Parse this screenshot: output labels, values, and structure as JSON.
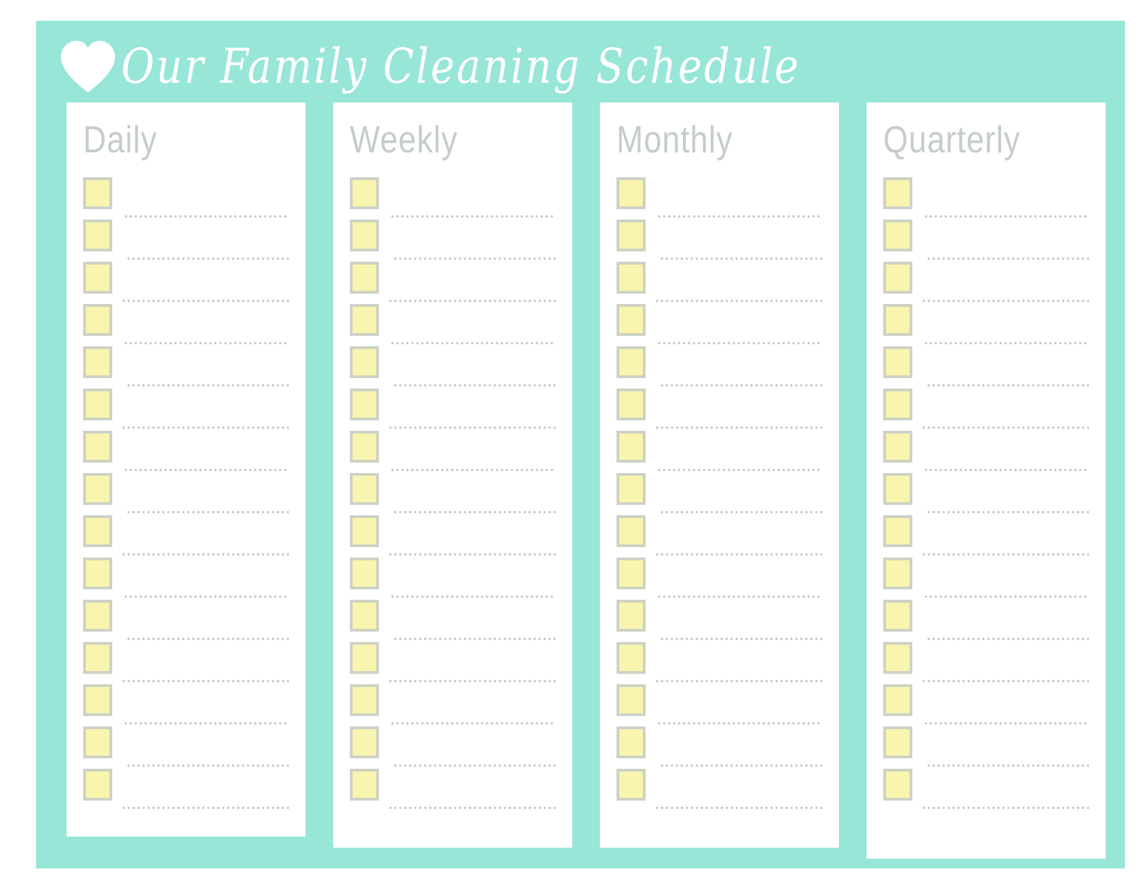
{
  "header": {
    "heart_icon": "heart-icon",
    "title": "Our Family Cleaning Schedule"
  },
  "colors": {
    "background": "#ffffff",
    "panel_teal": "#97e6d8",
    "card_white": "#ffffff",
    "checkbox_fill": "#f9f4ae",
    "checkbox_border": "#cdd2c4",
    "heading_gray": "#c5cdc9",
    "dotted_line_gray": "#c2cac8",
    "title_white": "#ffffff"
  },
  "columns": [
    {
      "id": "daily",
      "label": "Daily",
      "row_count": 15,
      "rows": [
        "",
        "",
        "",
        "",
        "",
        "",
        "",
        "",
        "",
        "",
        "",
        "",
        "",
        "",
        ""
      ]
    },
    {
      "id": "weekly",
      "label": "Weekly",
      "row_count": 15,
      "rows": [
        "",
        "",
        "",
        "",
        "",
        "",
        "",
        "",
        "",
        "",
        "",
        "",
        "",
        "",
        ""
      ]
    },
    {
      "id": "monthly",
      "label": "Monthly",
      "row_count": 15,
      "rows": [
        "",
        "",
        "",
        "",
        "",
        "",
        "",
        "",
        "",
        "",
        "",
        "",
        "",
        "",
        ""
      ]
    },
    {
      "id": "quarterly",
      "label": "Quarterly",
      "row_count": 15,
      "rows": [
        "",
        "",
        "",
        "",
        "",
        "",
        "",
        "",
        "",
        "",
        "",
        "",
        "",
        "",
        ""
      ]
    }
  ]
}
